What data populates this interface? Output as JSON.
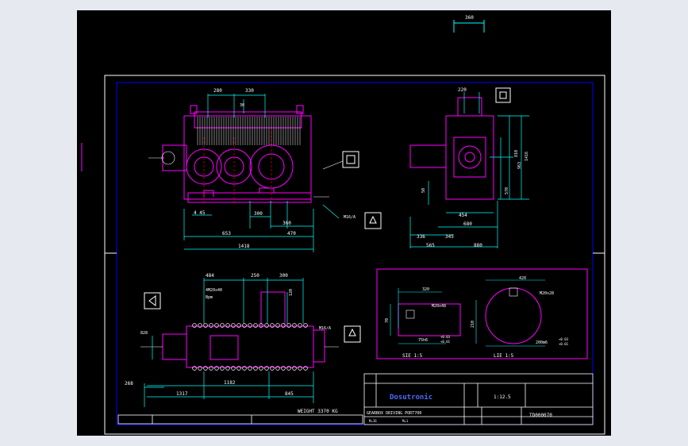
{
  "colors": {
    "background": "#e6e9f0",
    "drawing": "#000000",
    "border": "#ffffff",
    "dimension": "#00ffff",
    "body": "#ff00ff",
    "detail": "#ffffff",
    "hidden": "#ff0000"
  },
  "dims": {
    "top_left": "360",
    "front_top_a": "280",
    "front_top_b": "330",
    "front_top_c": "30",
    "side_top": "220",
    "front_hole": "4 45",
    "front_bot_a": "300",
    "front_bot_b": "360",
    "front_bot_c": "653",
    "front_bot_d": "470",
    "front_total": "1418",
    "side_h1": "810",
    "side_h2": "1416",
    "side_h3": "570",
    "side_h4": "963",
    "side_v": "50",
    "side_b1": "454",
    "side_b2": "680",
    "side_c1": "336",
    "side_c2": "345",
    "side_d1": "565",
    "side_d2": "880",
    "plan_top_a": "484",
    "plan_top_b": "250",
    "plan_top_c": "300",
    "plan_shaft": "120",
    "plan_bolt": "4M20x40",
    "plan_depth": "Bpm",
    "plan_left": "828",
    "plan_bot_a": "1182",
    "plan_bot_b": "1317",
    "plan_bot_c": "845",
    "plan_far_left": "268"
  },
  "callouts": {
    "oil_front": "M16/A",
    "oil_plan": "M16/A"
  },
  "weight": "WEIGHT 3370 KG",
  "details": {
    "a_dim": "320",
    "a_bolt": "M20x48",
    "a_side": "70",
    "a_bot": "75h6",
    "a_tol1": "+0.03",
    "a_tol2": "+0.01",
    "a_label": "SIE 1:5",
    "b_dim": "420",
    "b_bolt": "M20x28",
    "b_side": "210",
    "b_bot": "200m6",
    "b_tol1": "+0.03",
    "b_tol2": "+0.01",
    "b_label": "LIE 1:5"
  },
  "title_block": {
    "company": "Dosutronic",
    "scale": "1:12.5",
    "drawing_title": "GEARBOX  DRIVING  PORT700",
    "row_a": "M=16",
    "row_b": "M=1",
    "number": "TD000070"
  }
}
